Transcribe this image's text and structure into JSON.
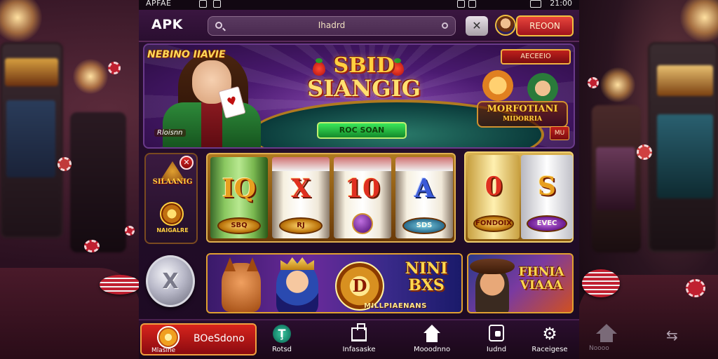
{
  "status_bar": {
    "left_label": "APFAE",
    "time": "21:00"
  },
  "header": {
    "logo": "APK",
    "search_text": "Ihadrd",
    "x_button": "✕",
    "register_label": "REOON"
  },
  "hero": {
    "dealer_title": "NEBINO IIAVIE",
    "card_label": "Rloisnn",
    "logo_line1": "SBID",
    "logo_line2": "SIANGIG",
    "button_label": "ROC SOAN",
    "corner_button": "AECEEIO",
    "side_logo": "MORFOTIANI",
    "side_logo_sub": "MIDORRIA",
    "small_button": "MU"
  },
  "side_panel": {
    "close": "✕",
    "logo1": "SILAANIG",
    "logo2": "NAIGALRE"
  },
  "reels": [
    {
      "symbol": "IQ",
      "plate": "SBQ",
      "style": "green"
    },
    {
      "symbol": "X",
      "plate": "RJ",
      "style": "red"
    },
    {
      "symbol": "10",
      "plate": "",
      "style": "red"
    },
    {
      "symbol": "A",
      "plate": "SDS",
      "style": "blue"
    }
  ],
  "reels2": [
    {
      "symbol": "0",
      "plate": "FONDOIX"
    },
    {
      "symbol": "S",
      "plate": "EVEC"
    }
  ],
  "promos": {
    "coin_symbol": "X",
    "medal_symbol": "D",
    "promo1_title_1": "NINI",
    "promo1_title_2": "BXS",
    "promo1_sub": "MILLPIAENANS",
    "promo2_title_1": "FHNIA",
    "promo2_title_2": "VIAAA"
  },
  "nav": {
    "active_label": "Mlasine",
    "active_big": "BOeSdono",
    "items": [
      {
        "label": "Rotsd",
        "icon": "shield-icon",
        "glyph": "Ţ"
      },
      {
        "label": "Infasaske",
        "icon": "building-icon"
      },
      {
        "label": "Mooodnno",
        "icon": "home-icon"
      },
      {
        "label": "Iudnd",
        "icon": "box-icon"
      },
      {
        "label": "Raceigese",
        "icon": "gear-icon",
        "glyph": "⚙"
      }
    ],
    "ghost_label": "Noooo"
  },
  "colors": {
    "accent_red": "#d8241c",
    "gold": "#ffd040",
    "purple_bg": "#2a0f30",
    "green_button": "#3ae85a"
  }
}
